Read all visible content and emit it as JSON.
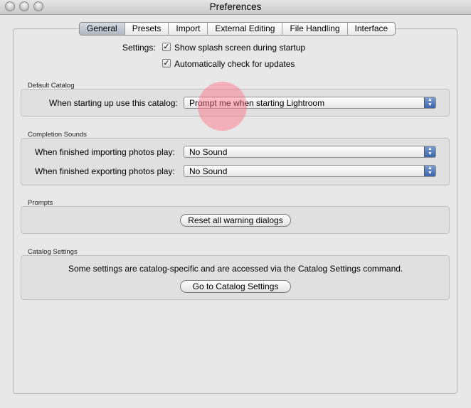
{
  "window": {
    "title": "Preferences"
  },
  "tabs": [
    "General",
    "Presets",
    "Import",
    "External Editing",
    "File Handling",
    "Interface"
  ],
  "settings": {
    "label": "Settings:",
    "splash_label": "Show splash screen during startup",
    "splash_checked": true,
    "updates_label": "Automatically check for updates",
    "updates_checked": true
  },
  "default_catalog": {
    "section_title": "Default Catalog",
    "label": "When starting up use this catalog:",
    "value": "Prompt me when starting Lightroom"
  },
  "completion_sounds": {
    "section_title": "Completion Sounds",
    "import_label": "When finished importing photos play:",
    "import_value": "No Sound",
    "export_label": "When finished exporting photos play:",
    "export_value": "No Sound"
  },
  "prompts": {
    "section_title": "Prompts",
    "reset_button": "Reset all warning dialogs"
  },
  "catalog_settings": {
    "section_title": "Catalog Settings",
    "description": "Some settings are catalog-specific and are accessed via the Catalog Settings command.",
    "button": "Go to Catalog Settings"
  }
}
